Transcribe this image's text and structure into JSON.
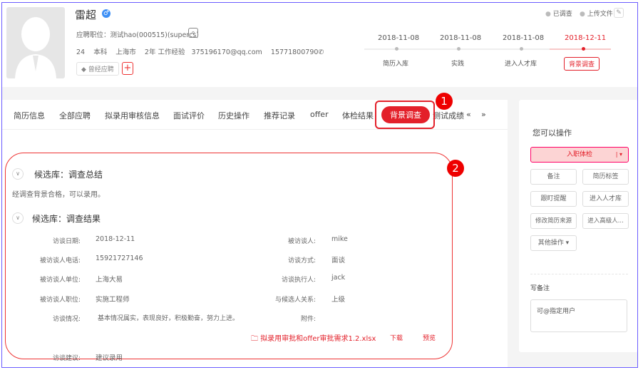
{
  "candidate": {
    "name": "雷超",
    "gender_icon": "male-icon",
    "position_label": "应聘职位：",
    "position": "测试hao(000515)(supercs)",
    "age": "24",
    "education": "本科",
    "city": "上海市",
    "experience": "2年 工作经验",
    "email": "375196170@qq.com",
    "phone": "15771800790",
    "tag_button": "曾经应聘",
    "add_button": "+"
  },
  "header_actions": {
    "investigated": "已调查",
    "upload": "上传文件"
  },
  "timeline": [
    {
      "date": "2018-11-08",
      "label": "简历入库"
    },
    {
      "date": "2018-11-08",
      "label": "实践"
    },
    {
      "date": "2018-11-08",
      "label": "进入人才库"
    },
    {
      "date": "2018-12-11",
      "label": "背景调查",
      "active": true
    }
  ],
  "tabs": [
    "简历信息",
    "全部应聘",
    "拟录用审核信息",
    "面试评价",
    "历史操作",
    "推荐记录",
    "offer",
    "体检结果",
    "背景调查",
    "测试成绩"
  ],
  "annotations": [
    "1",
    "2"
  ],
  "summary": {
    "title": "候选库：调查总结",
    "text": "经调查背景合格，可以录用。"
  },
  "result": {
    "title": "候选库：调查结果",
    "left": [
      {
        "label": "访谈日期:",
        "value": "2018-12-11"
      },
      {
        "label": "被访谈人电话:",
        "value": "15921727146"
      },
      {
        "label": "被访谈人单位:",
        "value": "上海大易"
      },
      {
        "label": "被访谈人职位:",
        "value": "实施工程师"
      },
      {
        "label": "访谈情况:",
        "value": "基本情况属实，表现良好，积极勤奋，努力上进。"
      }
    ],
    "right": [
      {
        "label": "被访谈人:",
        "value": "mike"
      },
      {
        "label": "访谈方式:",
        "value": "面谈"
      },
      {
        "label": "访谈执行人:",
        "value": "jack"
      },
      {
        "label": "与候选人关系:",
        "value": "上级"
      },
      {
        "label": "附件:",
        "value": ""
      }
    ],
    "attachment": "拟录用审批和offer审批需求1.2.xlsx",
    "download": "下载",
    "preview": "预览",
    "suggestion_label": "访谈建议:",
    "suggestion": "建议录用"
  },
  "side": {
    "title": "您可以操作",
    "primary": "入职体检",
    "buttons": [
      "备注",
      "简历标签",
      "跟盯提醒",
      "进入人才库",
      "修改简历来源",
      "进入高级人..."
    ],
    "other": "其他操作",
    "note_title": "写备注",
    "note_placeholder": "可@指定用户"
  }
}
